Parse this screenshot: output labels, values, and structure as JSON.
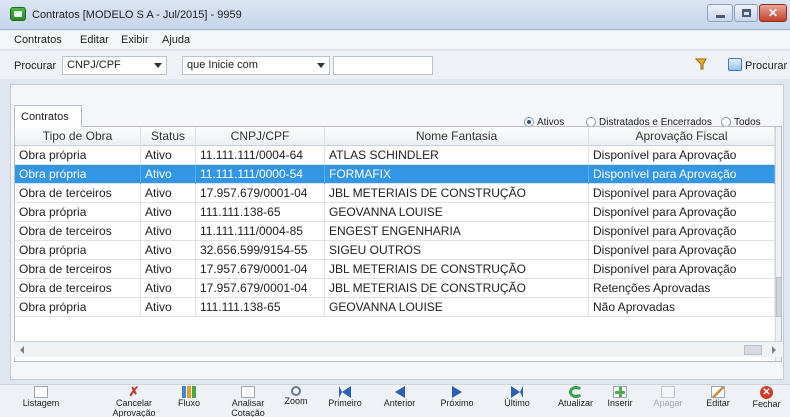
{
  "window": {
    "title": "Contratos [MODELO S A - Jul/2015] - 9959"
  },
  "menu": [
    "Contratos",
    "Editar",
    "Exibir",
    "Ajuda"
  ],
  "search": {
    "label": "Procurar",
    "field": "CNPJ/CPF",
    "mode": "que Inicie com",
    "value": "",
    "button_label": "Procurar"
  },
  "filters": {
    "options": [
      "Ativos",
      "Distratados e Encerrados",
      "Todos"
    ],
    "selected": "Ativos"
  },
  "tab": "Contratos",
  "table": {
    "columns": [
      "Tipo de Obra",
      "Status",
      "CNPJ/CPF",
      "Nome Fantasia",
      "Aprovação Fiscal"
    ],
    "rows": [
      [
        "Obra própria",
        "Ativo",
        "11.111.111/0004-64",
        "ATLAS SCHINDLER",
        "Disponível para Aprovação"
      ],
      [
        "Obra própria",
        "Ativo",
        "11.111.111/0000-54",
        "FORMAFIX",
        "Disponível para Aprovação"
      ],
      [
        "Obra de terceiros",
        "Ativo",
        "17.957.679/0001-04",
        "JBL METERIAIS DE CONSTRUÇÃO",
        "Disponível para Aprovação"
      ],
      [
        "Obra própria",
        "Ativo",
        "111.111.138-65",
        "GEOVANNA LOUISE",
        "Disponível para Aprovação"
      ],
      [
        "Obra de terceiros",
        "Ativo",
        "11.111.111/0004-85",
        "ENGEST ENGENHARIA",
        "Disponível para Aprovação"
      ],
      [
        "Obra própria",
        "Ativo",
        "32.656.599/9154-55",
        "SIGEU OUTROS",
        "Disponível para Aprovação"
      ],
      [
        "Obra de terceiros",
        "Ativo",
        "17.957.679/0001-04",
        "JBL METERIAIS DE CONSTRUÇÃO",
        "Disponível para Aprovação"
      ],
      [
        "Obra de terceiros",
        "Ativo",
        "17.957.679/0001-04",
        "JBL METERIAIS DE CONSTRUÇÃO",
        "Retenções Aprovadas"
      ],
      [
        "Obra própria",
        "Ativo",
        "111.111.138-65",
        "GEOVANNA LOUISE",
        "Não Aprovadas"
      ]
    ],
    "selected_row": 1
  },
  "toolbar": [
    {
      "label": "Listagem",
      "icon": "document-icon",
      "enabled": true
    },
    {
      "label": "Cancelar\nAprovação",
      "icon": "cancel-x-icon",
      "enabled": true
    },
    {
      "label": "Fluxo",
      "icon": "flow-chart-icon",
      "enabled": true
    },
    {
      "label": "Analisar\nCotação",
      "icon": "analyze-icon",
      "enabled": true
    },
    {
      "label": "Zoom",
      "icon": "zoom-icon",
      "enabled": true
    },
    {
      "label": "Primeiro",
      "icon": "first-icon",
      "enabled": true
    },
    {
      "label": "Anterior",
      "icon": "previous-icon",
      "enabled": true
    },
    {
      "label": "Próximo",
      "icon": "next-icon",
      "enabled": true
    },
    {
      "label": "Último",
      "icon": "last-icon",
      "enabled": true
    },
    {
      "label": "Atualizar",
      "icon": "refresh-icon",
      "enabled": true
    },
    {
      "label": "Inserir",
      "icon": "insert-icon",
      "enabled": true
    },
    {
      "label": "Apagar",
      "icon": "delete-icon",
      "enabled": false
    },
    {
      "label": "Editar",
      "icon": "edit-icon",
      "enabled": true
    },
    {
      "label": "Fechar",
      "icon": "close-icon",
      "enabled": true
    }
  ],
  "colors": {
    "selection": "#3296e6",
    "titlebar": "#c6d5ea"
  }
}
